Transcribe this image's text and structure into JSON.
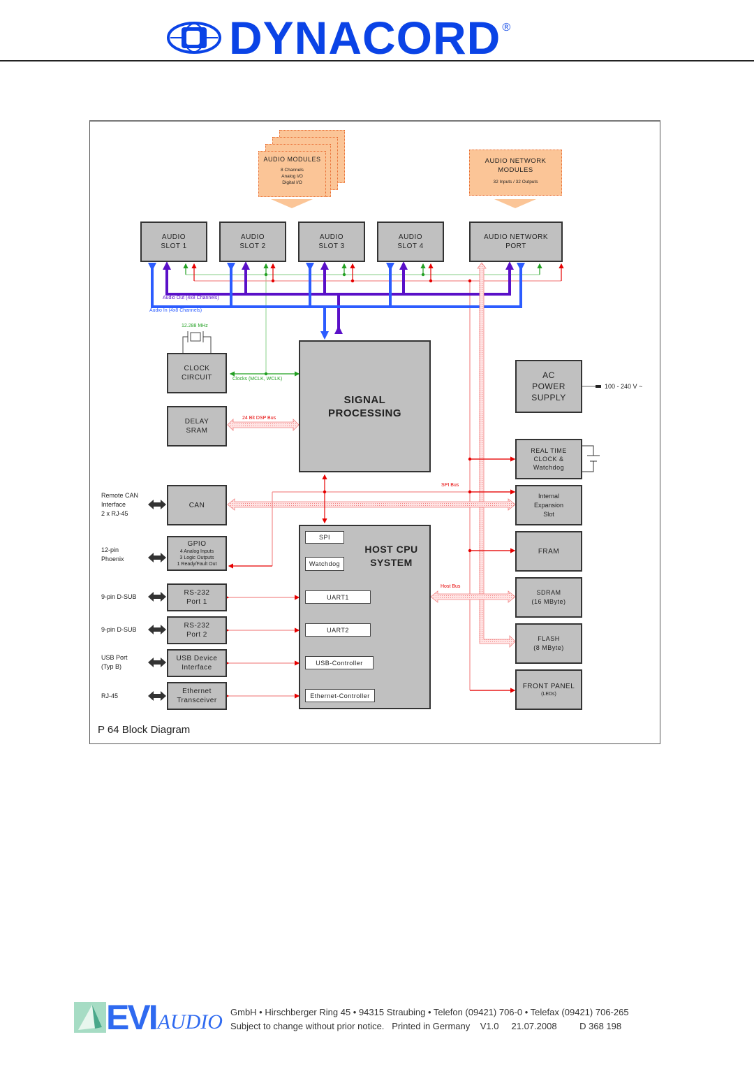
{
  "header": {
    "brand": "DYNACORD",
    "registered": "®",
    "logo_icon": "dynacord-d-globe-icon",
    "brand_color": "#0a43e6"
  },
  "diagram": {
    "caption": "P 64 Block Diagram",
    "colors": {
      "box_fill": "#c0c0c0",
      "module_fill": "#fbc597",
      "audio_in": "#2c5cff",
      "audio_out": "#5a10c8",
      "clock": "#22a022",
      "control": "#e60000"
    },
    "modules": {
      "audio_modules": {
        "title": "AUDIO MODULES",
        "lines": [
          "8 Channels",
          "Analog I/O",
          "Digital I/O"
        ]
      },
      "audio_network_modules": {
        "title1": "AUDIO NETWORK",
        "title2": "MODULES",
        "detail": "32 Inputs / 32 Outputs"
      }
    },
    "slots": [
      {
        "line1": "AUDIO",
        "line2": "SLOT 1"
      },
      {
        "line1": "AUDIO",
        "line2": "SLOT 2"
      },
      {
        "line1": "AUDIO",
        "line2": "SLOT 3"
      },
      {
        "line1": "AUDIO",
        "line2": "SLOT 4"
      },
      {
        "line1": "AUDIO NETWORK",
        "line2": "PORT"
      }
    ],
    "bus_labels": {
      "audio_out": "Audio Out (4x8 Channels)",
      "audio_in": "Audio In (4x8 Channels)",
      "crystal": "12.288 MHz",
      "clocks": "Clocks (MCLK, WCLK)",
      "dsp_bus": "24 Bit DSP Bus",
      "spi_bus": "SPI Bus",
      "host_bus": "Host Bus"
    },
    "blocks": {
      "clock_circuit": [
        "CLOCK",
        "CIRCUIT"
      ],
      "delay_sram": [
        "DELAY",
        "SRAM"
      ],
      "signal_processing": [
        "SIGNAL",
        "PROCESSING"
      ],
      "ac_power": [
        "AC",
        "POWER",
        "SUPPLY"
      ],
      "power_input": "100 - 240 V ~",
      "rtc": [
        "REAL TIME",
        "CLOCK &",
        "Watchdog"
      ],
      "expansion": [
        "Internal",
        "Expansion",
        "Slot"
      ],
      "fram": "FRAM",
      "sdram": [
        "SDRAM",
        "(16 MByte)"
      ],
      "flash": [
        "FLASH",
        "(8 MByte)"
      ],
      "front_panel": [
        "FRONT PANEL",
        "(LEDs)"
      ],
      "can": "CAN",
      "gpio": {
        "title": "GPIO",
        "lines": [
          "4 Analog Inputs",
          "3 Logic Outputs",
          "1 Ready/Fault Out"
        ]
      },
      "rs232_1": [
        "RS-232",
        "Port 1"
      ],
      "rs232_2": [
        "RS-232",
        "Port 2"
      ],
      "usb": [
        "USB Device",
        "Interface"
      ],
      "ethernet": [
        "Ethernet",
        "Transceiver"
      ],
      "host_cpu": [
        "HOST CPU",
        "SYSTEM"
      ],
      "host_sub": [
        "SPI",
        "Watchdog",
        "UART1",
        "UART2",
        "USB-Controller",
        "Ethernet-Controller"
      ]
    },
    "connectors": {
      "can": [
        "Remote CAN",
        "Interface",
        "2 x RJ-45"
      ],
      "gpio": [
        "12-pin",
        "Phoenix"
      ],
      "rs232_1": "9-pin D-SUB",
      "rs232_2": "9-pin D-SUB",
      "usb": [
        "USB Port",
        "(Typ B)"
      ],
      "ethernet": "RJ-45"
    }
  },
  "footer": {
    "logo_evi": "EVI",
    "logo_audio": "AUDIO",
    "logo_icon": "evi-pyramid-icon",
    "address": "GmbH • Hirschberger Ring 45 • 94315 Straubing • Telefon (09421) 706-0 • Telefax (09421) 706-265",
    "notice": "Subject to change without prior notice.",
    "printed": "Printed in Germany",
    "version": "V1.0",
    "date": "21.07.2008",
    "doc_number": "D 368 198"
  }
}
